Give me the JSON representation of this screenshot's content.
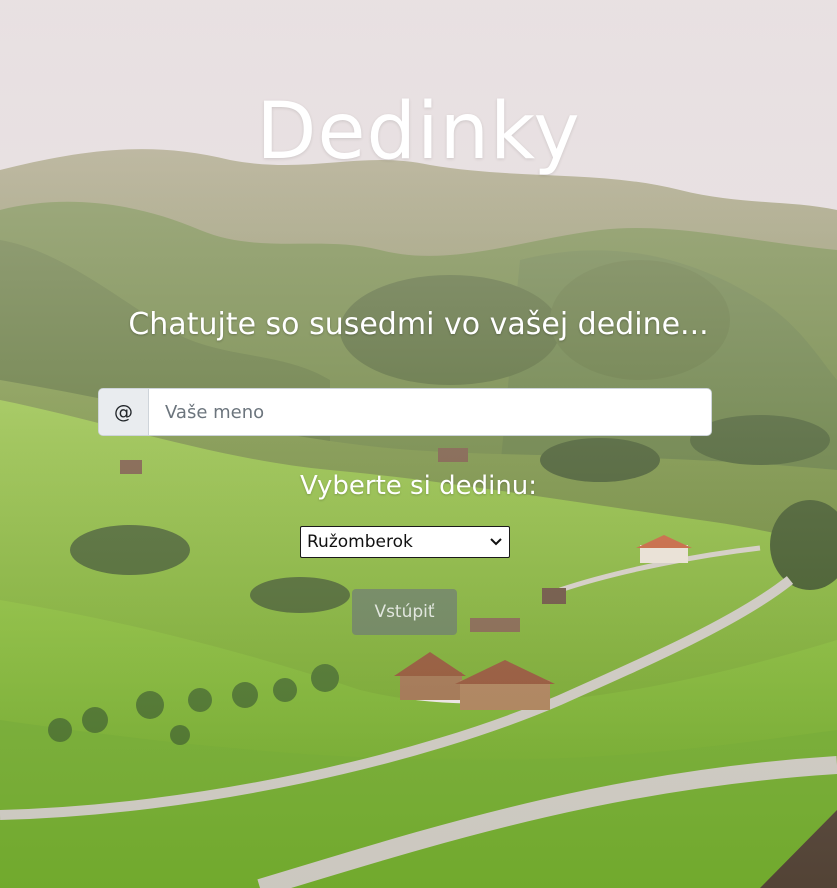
{
  "header": {
    "title": "Dedinky",
    "tagline": "Chatujte so susedmi vo vašej dedine..."
  },
  "form": {
    "name_prefix": "@",
    "name_placeholder": "Vaše meno",
    "name_value": "",
    "select_label": "Vyberte si dedinu:",
    "selected_village": "Ružomberok",
    "submit_label": "Vstúpiť"
  },
  "colors": {
    "sky": "#e9e4e6",
    "hills_dark": "#4f6b2a",
    "meadow": "#7fb52a",
    "button_disabled": "#6c757d"
  },
  "icons": {
    "select_arrow": "chevron-down-icon",
    "background": "landscape-background"
  }
}
